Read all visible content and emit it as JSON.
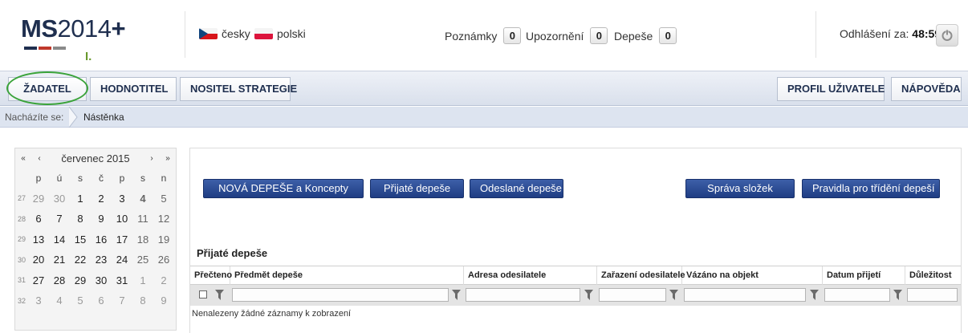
{
  "logo": {
    "ms": "MS",
    "year": "2014",
    "plus": "+",
    "sub": "I.",
    "bar_colors": [
      "#1f2f4f",
      "#c0392b",
      "#7a7a7a"
    ]
  },
  "languages": [
    {
      "label": "česky",
      "flag": "cz-flag-icon"
    },
    {
      "label": "polski",
      "flag": "pl-flag-icon"
    }
  ],
  "counters": [
    {
      "label": "Poznámky",
      "count": "0"
    },
    {
      "label": "Upozornění",
      "count": "0"
    },
    {
      "label": "Depeše",
      "count": "0"
    }
  ],
  "logout": {
    "label": "Odhlášení za:",
    "time": "48:59",
    "icon": "power-icon"
  },
  "nav": {
    "left": [
      "ŽADATEL",
      "HODNOTITEL",
      "NOSITEL STRATEGIE"
    ],
    "right": [
      "PROFIL UŽIVATELE",
      "NÁPOVĚDA"
    ]
  },
  "breadcrumb": {
    "label": "Nacházíte se:",
    "item": "Nástěnka"
  },
  "calendar": {
    "month": "červenec 2015",
    "nav": {
      "prev_year": "«",
      "prev": "‹",
      "next": "›",
      "next_year": "»"
    },
    "weekdays": [
      "p",
      "ú",
      "s",
      "č",
      "p",
      "s",
      "n"
    ],
    "weeks": [
      {
        "num": "27",
        "days": [
          "29",
          "30",
          "1",
          "2",
          "3",
          "4",
          "5"
        ]
      },
      {
        "num": "28",
        "days": [
          "6",
          "7",
          "8",
          "9",
          "10",
          "11",
          "12"
        ]
      },
      {
        "num": "29",
        "days": [
          "13",
          "14",
          "15",
          "16",
          "17",
          "18",
          "19"
        ]
      },
      {
        "num": "30",
        "days": [
          "20",
          "21",
          "22",
          "23",
          "24",
          "25",
          "26"
        ]
      },
      {
        "num": "31",
        "days": [
          "27",
          "28",
          "29",
          "30",
          "31",
          "1",
          "2"
        ]
      },
      {
        "num": "32",
        "days": [
          "3",
          "4",
          "5",
          "6",
          "7",
          "8",
          "9"
        ]
      }
    ]
  },
  "actions": {
    "new": "NOVÁ DEPEŠE a Koncepty",
    "received": "Přijaté depeše",
    "sent": "Odeslané depeše",
    "folders": "Správa složek",
    "rules": "Pravidla pro třídění depeší"
  },
  "table": {
    "title": "Přijaté depeše",
    "columns": [
      "Přečteno",
      "Předmět depeše",
      "Adresa odesilatele",
      "Zařazení odesilatele",
      "Vázáno na objekt",
      "Datum přijetí",
      "Důležitost"
    ],
    "empty": "Nenalezeny žádné záznamy k zobrazení"
  },
  "colors": {
    "accent": "#1f3d83",
    "nav_bg": "#dde4f0",
    "highlight": "#3aa33a"
  }
}
